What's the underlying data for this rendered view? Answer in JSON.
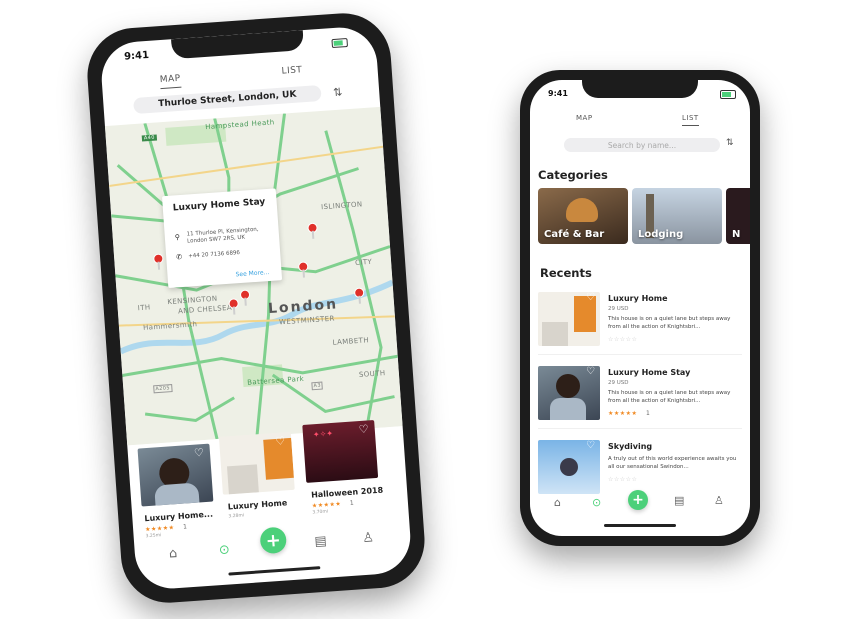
{
  "left": {
    "status_time": "9:41",
    "tabs": {
      "map": "MAP",
      "list": "LIST"
    },
    "location": "Thurloe Street, London, UK",
    "map_labels": {
      "hampstead": "Hampstead Heath",
      "islington": "ISLINGTON",
      "london": "London",
      "westminster": "WESTMINSTER",
      "kensington": "KENSINGTON",
      "and_chelsea": "AND CHELSEA",
      "lambeth": "LAMBETH",
      "hammersmith": "Hammersmith",
      "battersea": "Battersea Park",
      "south": "SOUTH",
      "city": "CITY",
      "a40": "A40",
      "a205": "A205",
      "a3": "A3",
      "ith": "ITH"
    },
    "popup": {
      "title": "Luxury Home Stay",
      "address": "11 Thurloe Pl, Kensington, London SW7 2RS, UK",
      "phone": "+44 20 7136 6896",
      "more": "See More..."
    },
    "cards": [
      {
        "title": "Luxury Home...",
        "stars": "★★★★★",
        "count": "1",
        "sub": "3.25mi"
      },
      {
        "title": "Luxury Home",
        "sub": "3.28mi"
      },
      {
        "title": "Halloween 2018",
        "stars": "★★★★★",
        "count": "1",
        "sub": "3.70mi"
      }
    ],
    "nav": {
      "home": "⌂",
      "map": "⊙",
      "add": "+",
      "list": "▤",
      "profile": "♙"
    }
  },
  "right": {
    "status_time": "9:41",
    "tabs": {
      "map": "MAP",
      "list": "LIST"
    },
    "search_placeholder": "Search by name...",
    "categories_title": "Categories",
    "categories": [
      {
        "label": "Café & Bar"
      },
      {
        "label": "Lodging"
      },
      {
        "label": "N"
      }
    ],
    "recents_title": "Recents",
    "recents": [
      {
        "title": "Luxury Home",
        "price": "29 USD",
        "desc": "This house is on a quiet lane but steps away from all the action of Knightsbri...",
        "stars": "☆☆☆☆☆"
      },
      {
        "title": "Luxury Home Stay",
        "price": "29 USD",
        "desc": "This house is on a quiet lane but steps away from all the action of Knightsbri...",
        "stars": "★★★★★",
        "count": "1"
      },
      {
        "title": "Skydiving",
        "desc": "A truly out of this world experience awaits you all our sensational Swindon...",
        "stars": "☆☆☆☆☆"
      }
    ],
    "nav": {
      "home": "⌂",
      "map": "⊙",
      "add": "+",
      "list": "▤",
      "profile": "♙"
    }
  },
  "colors": {
    "accent": "#4cd07a",
    "pin": "#e0302a",
    "star": "#f08a24",
    "link": "#3aa3e0"
  }
}
